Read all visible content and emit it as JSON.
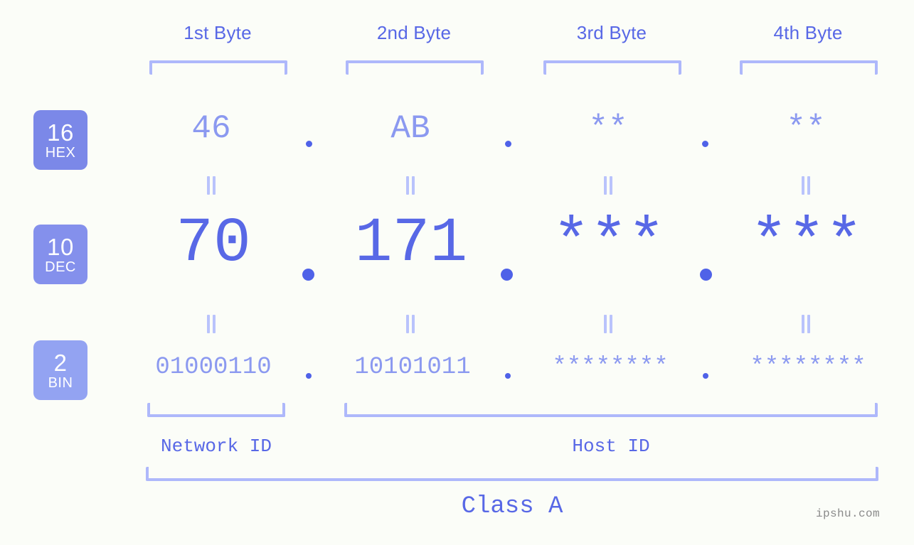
{
  "meta": {
    "background_color": "#fbfdf8",
    "accent_dark": "#5868e6",
    "accent_mid": "#8b99f0",
    "accent_light": "#aeb8fb",
    "watermark": "ipshu.com"
  },
  "byte_headers": [
    {
      "label": "1st Byte"
    },
    {
      "label": "2nd Byte"
    },
    {
      "label": "3rd Byte"
    },
    {
      "label": "4th Byte"
    }
  ],
  "bases": [
    {
      "radix": "16",
      "name": "HEX",
      "color": "#7b88e8"
    },
    {
      "radix": "10",
      "name": "DEC",
      "color": "#8490ec"
    },
    {
      "radix": "2",
      "name": "BIN",
      "color": "#93a3f2"
    }
  ],
  "rows": {
    "hex": {
      "values": [
        "46",
        "AB",
        "**",
        "**"
      ],
      "separator": "."
    },
    "dec": {
      "values": [
        "70",
        "171",
        "***",
        "***"
      ],
      "separator": "."
    },
    "bin": {
      "values": [
        "01000110",
        "10101011",
        "********",
        "********"
      ],
      "separator": "."
    }
  },
  "equals_symbol": "=",
  "sections": {
    "network_id": "Network ID",
    "host_id": "Host ID",
    "class": "Class A"
  }
}
